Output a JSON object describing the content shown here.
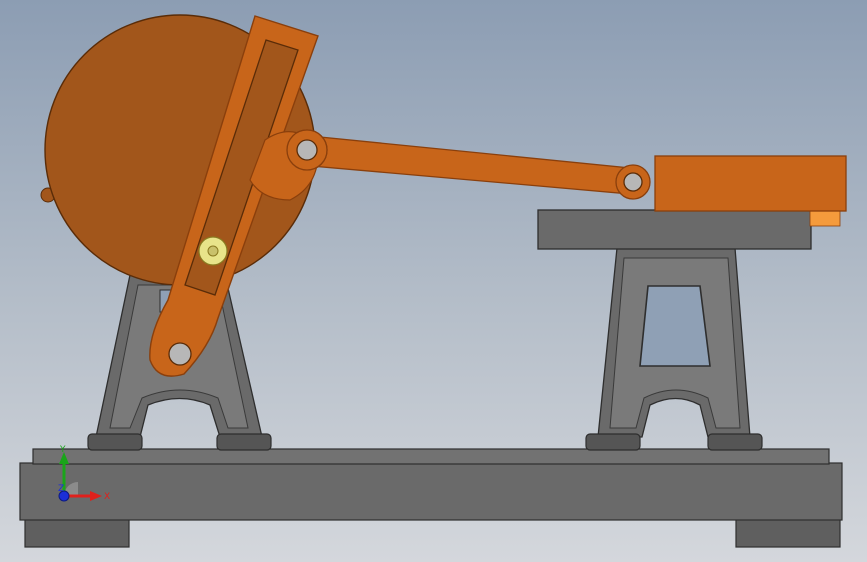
{
  "viewport": {
    "background_top": "#8c9db3",
    "background_bottom": "#d4d7dc"
  },
  "colors": {
    "orange_part": "#c8651a",
    "orange_dark": "#8a3f0c",
    "flywheel": "#a2561b",
    "gray_part": "#6a6a6a",
    "gray_light": "#7c7c7c",
    "gray_edge": "#2e2e2e",
    "pin": "#e8e48a",
    "axis_x": "#e0201c",
    "axis_y": "#1aa51a",
    "axis_z": "#1b2fd8",
    "crosshead_tab": "#f59b3c"
  },
  "triad": {
    "x_label": "X",
    "y_label": "Y",
    "z_label": "Z"
  }
}
